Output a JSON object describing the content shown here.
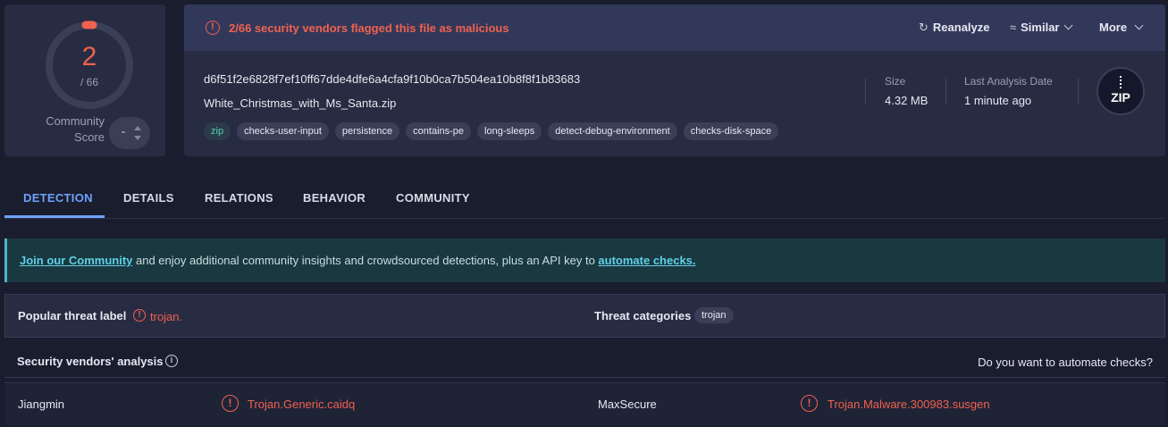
{
  "score": {
    "detections": "2",
    "total": "/ 66",
    "community_label_line1": "Community",
    "community_label_line2": "Score",
    "vote_placeholder": "-",
    "accent_color": "#f0614f"
  },
  "header": {
    "alert_text": "2/66 security vendors flagged this file as malicious",
    "alert_icon": "exclamation-circle-icon",
    "actions": {
      "reanalyze": "Reanalyze",
      "similar": "Similar",
      "more": "More"
    }
  },
  "file": {
    "hash": "d6f51f2e6828f7ef10ff67dde4dfe6a4cfa9f10b0ca7b504ea10b8f8f1b83683",
    "name": "White_Christmas_with_Ms_Santa.zip",
    "tags": [
      "zip",
      "checks-user-input",
      "persistence",
      "contains-pe",
      "long-sleeps",
      "detect-debug-environment",
      "checks-disk-space"
    ],
    "size_label": "Size",
    "size_value": "4.32 MB",
    "last_analysis_label": "Last Analysis Date",
    "last_analysis_value": "1 minute ago",
    "type_icon_text": "ZIP"
  },
  "tabs": [
    "DETECTION",
    "DETAILS",
    "RELATIONS",
    "BEHAVIOR",
    "COMMUNITY"
  ],
  "banner": {
    "link1": "Join our Community",
    "middle": " and enjoy additional community insights and crowdsourced detections, plus an API key to ",
    "link2": "automate checks."
  },
  "threat": {
    "popular_label": "Popular threat label",
    "popular_value": "trojan.",
    "categories_label": "Threat categories",
    "categories_value": "trojan"
  },
  "vendors": {
    "title": "Security vendors' analysis",
    "automate_prompt": "Do you want to automate checks?",
    "rows": [
      {
        "vendor1": "Jiangmin",
        "result1": "Trojan.Generic.caidq",
        "vendor2": "MaxSecure",
        "result2": "Trojan.Malware.300983.susgen"
      }
    ]
  }
}
